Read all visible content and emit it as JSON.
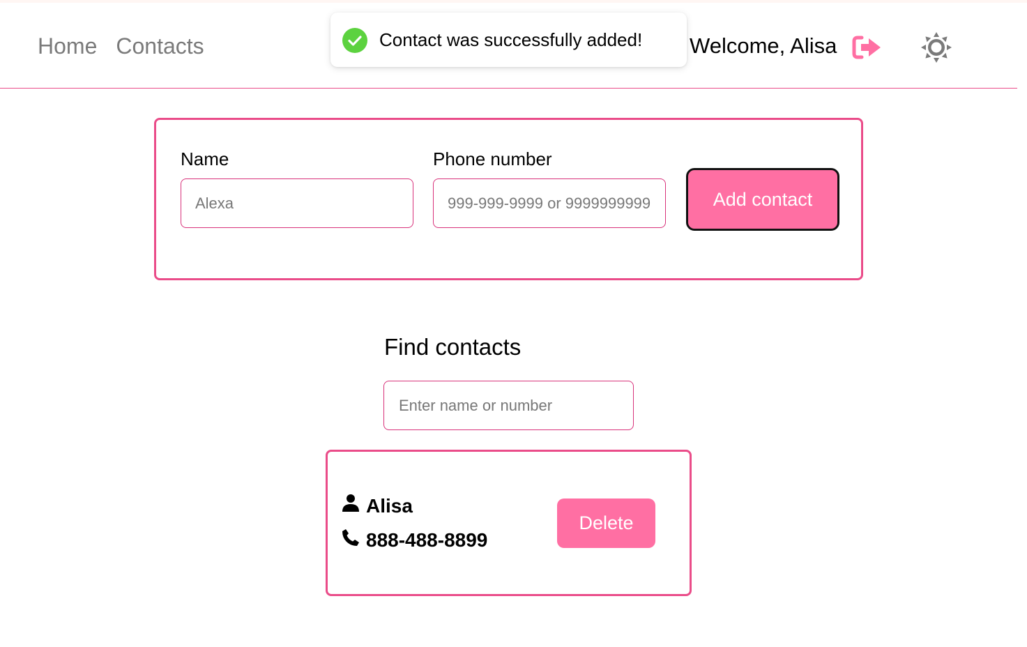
{
  "header": {
    "nav": [
      {
        "label": "Home"
      },
      {
        "label": "Contacts"
      }
    ],
    "welcome_text": "Welcome, Alisa",
    "logout_icon": "logout-icon",
    "theme_icon": "sun-icon"
  },
  "toast": {
    "message": "Contact was successfully added!",
    "icon": "check-circle-icon",
    "icon_color": "#5cd23f"
  },
  "add_form": {
    "name_label": "Name",
    "name_placeholder": "Alexa",
    "phone_label": "Phone number",
    "phone_placeholder": "999-999-9999 or 9999999999",
    "submit_label": "Add contact"
  },
  "find": {
    "title": "Find contacts",
    "placeholder": "Enter name or number"
  },
  "contacts": [
    {
      "name": "Alisa",
      "number": "888-488-8899",
      "delete_label": "Delete"
    }
  ],
  "colors": {
    "accent": "#ea4c89",
    "button": "#ff6fa3",
    "nav_text": "#7a7a7a"
  }
}
